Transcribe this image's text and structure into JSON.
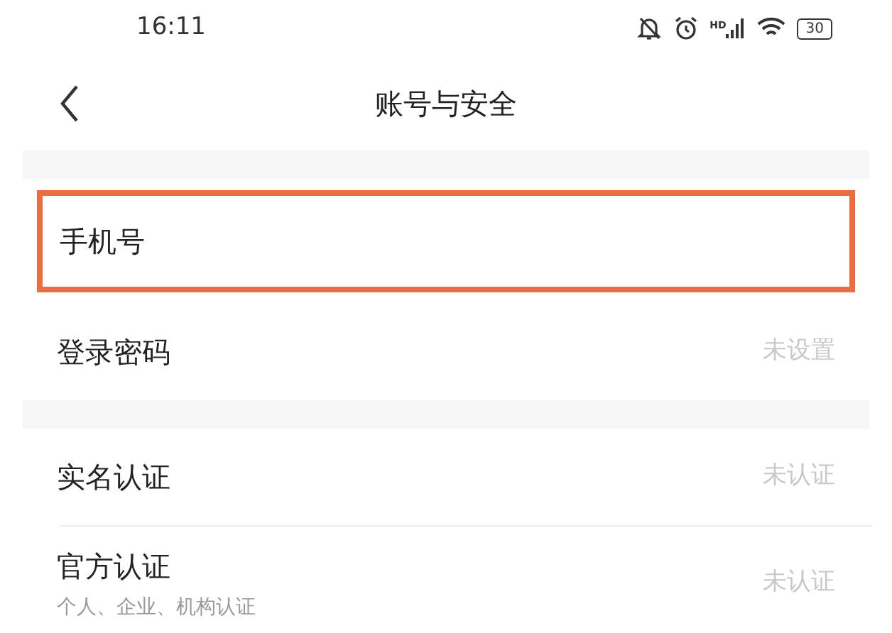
{
  "status_bar": {
    "time": "16:11",
    "network_label": "HD",
    "battery": "30"
  },
  "header": {
    "title": "账号与安全"
  },
  "groups": [
    {
      "items": [
        {
          "label": "手机号",
          "highlighted": true
        },
        {
          "label": "登录密码",
          "value": "未设置",
          "highlighted": false
        }
      ]
    },
    {
      "items": [
        {
          "label": "实名认证",
          "value": "未认证",
          "highlighted": false
        },
        {
          "label": "官方认证",
          "sublabel": "个人、企业、机构认证",
          "value": "未认证",
          "highlighted": false
        }
      ]
    }
  ]
}
